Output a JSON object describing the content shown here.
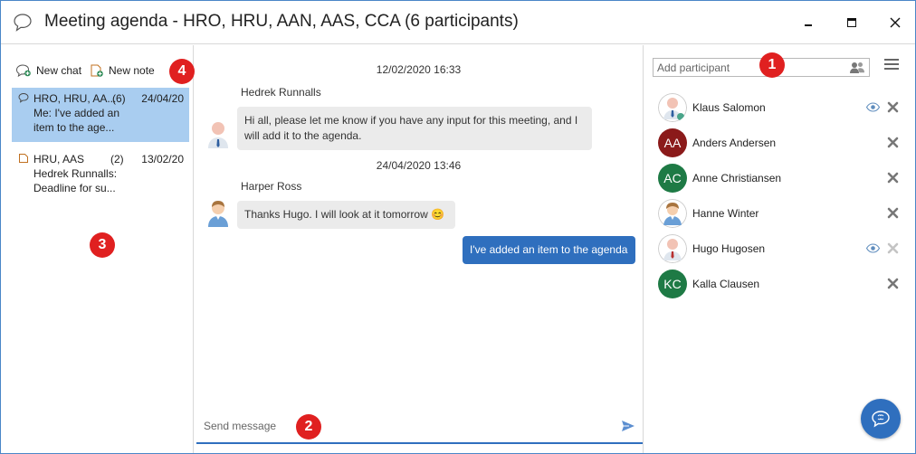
{
  "window": {
    "title": "Meeting agenda - HRO, HRU, AAN, AAS, CCA (6 participants)",
    "accent": "#2f6fbe"
  },
  "toolbar": {
    "new_chat": "New chat",
    "new_note": "New note"
  },
  "conversations": [
    {
      "name": "HRO, HRU, AA...",
      "count": "(6)",
      "date": "24/04/20",
      "preview": "Me: I've added an\nitem to the age...",
      "icon": "chat-bubble-icon",
      "selected": true
    },
    {
      "name": "HRU, AAS",
      "count": "(2)",
      "date": "13/02/20",
      "preview": "Hedrek Runnalls:\nDeadline for su...",
      "icon": "note-icon",
      "selected": false
    }
  ],
  "messages": [
    {
      "timestamp": "12/02/2020 16:33",
      "sender": "Hedrek Runnalls",
      "text": "Hi all, please let me know if you have any input for this meeting, and I\nwill add it to the agenda."
    },
    {
      "timestamp": "24/04/2020 13:46",
      "sender": "Harper Ross",
      "text": "Thanks Hugo. I will look at it tomorrow 😊"
    },
    {
      "outgoing": true,
      "text": "I've added an item to the agenda"
    }
  ],
  "composer": {
    "placeholder": "Send message"
  },
  "participants_panel": {
    "add_placeholder": "Add participant",
    "participants": [
      {
        "name": "Klaus Salomon",
        "avatar": "photo",
        "eye": true
      },
      {
        "name": "Anders Andersen",
        "initials": "AA",
        "color": "#8b1a1a",
        "eye": false
      },
      {
        "name": "Anne Christiansen",
        "initials": "AC",
        "color": "#1e7a45",
        "eye": false
      },
      {
        "name": "Hanne Winter",
        "avatar": "photo",
        "eye": false
      },
      {
        "name": "Hugo Hugosen",
        "avatar": "photo",
        "eye": true
      },
      {
        "name": "Kalla Clausen",
        "initials": "KC",
        "color": "#1e7a45",
        "eye": false
      }
    ]
  },
  "annotations": {
    "b1": "1",
    "b2": "2",
    "b3": "3",
    "b4": "4",
    "color": "#e02020"
  }
}
